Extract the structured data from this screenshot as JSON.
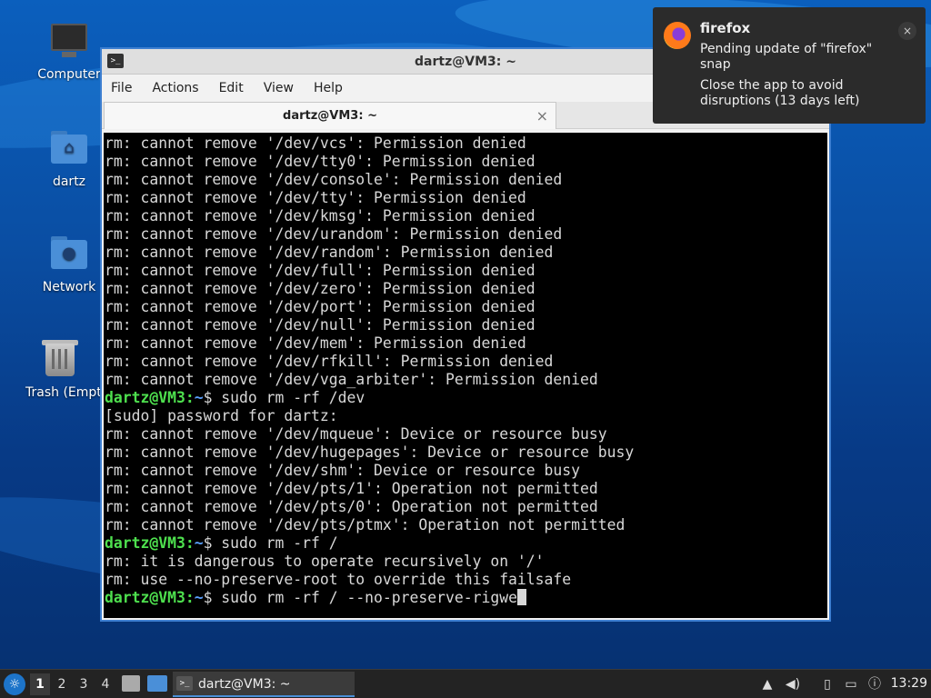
{
  "desktop": {
    "icons": [
      {
        "label": "Computer"
      },
      {
        "label": "dartz"
      },
      {
        "label": "Network"
      },
      {
        "label": "Trash (Empty)"
      }
    ]
  },
  "window": {
    "title": "dartz@VM3: ~",
    "menu": [
      "File",
      "Actions",
      "Edit",
      "View",
      "Help"
    ],
    "tab_label": "dartz@VM3: ~",
    "tab_close": "×"
  },
  "terminal": {
    "lines": [
      {
        "text": "rm: cannot remove '/dev/vcs': Permission denied"
      },
      {
        "text": "rm: cannot remove '/dev/tty0': Permission denied"
      },
      {
        "text": "rm: cannot remove '/dev/console': Permission denied"
      },
      {
        "text": "rm: cannot remove '/dev/tty': Permission denied"
      },
      {
        "text": "rm: cannot remove '/dev/kmsg': Permission denied"
      },
      {
        "text": "rm: cannot remove '/dev/urandom': Permission denied"
      },
      {
        "text": "rm: cannot remove '/dev/random': Permission denied"
      },
      {
        "text": "rm: cannot remove '/dev/full': Permission denied"
      },
      {
        "text": "rm: cannot remove '/dev/zero': Permission denied"
      },
      {
        "text": "rm: cannot remove '/dev/port': Permission denied"
      },
      {
        "text": "rm: cannot remove '/dev/null': Permission denied"
      },
      {
        "text": "rm: cannot remove '/dev/mem': Permission denied"
      },
      {
        "text": "rm: cannot remove '/dev/rfkill': Permission denied"
      },
      {
        "text": "rm: cannot remove '/dev/vga_arbiter': Permission denied"
      },
      {
        "prompt": true,
        "user": "dartz@VM3",
        "path": "~",
        "cmd": "$ sudo rm -rf /dev"
      },
      {
        "text": "[sudo] password for dartz:"
      },
      {
        "text": "rm: cannot remove '/dev/mqueue': Device or resource busy"
      },
      {
        "text": "rm: cannot remove '/dev/hugepages': Device or resource busy"
      },
      {
        "text": "rm: cannot remove '/dev/shm': Device or resource busy"
      },
      {
        "text": "rm: cannot remove '/dev/pts/1': Operation not permitted"
      },
      {
        "text": "rm: cannot remove '/dev/pts/0': Operation not permitted"
      },
      {
        "text": "rm: cannot remove '/dev/pts/ptmx': Operation not permitted"
      },
      {
        "prompt": true,
        "user": "dartz@VM3",
        "path": "~",
        "cmd": "$ sudo rm -rf /"
      },
      {
        "text": "rm: it is dangerous to operate recursively on '/'"
      },
      {
        "text": "rm: use --no-preserve-root to override this failsafe"
      },
      {
        "prompt": true,
        "user": "dartz@VM3",
        "path": "~",
        "cmd": "$ sudo rm -rf / --no-preserve-rigwe",
        "cursor": true
      }
    ]
  },
  "notification": {
    "title": "firefox",
    "line1": "Pending update of \"firefox\" snap",
    "line2": "Close the app to avoid disruptions (13 days left)",
    "close": "×"
  },
  "taskbar": {
    "workspaces": [
      "1",
      "2",
      "3",
      "4"
    ],
    "active_workspace": "1",
    "task_label": "dartz@VM3: ~",
    "clock": "13:29"
  },
  "colors": {
    "prompt_user": "#4ee04e",
    "prompt_path": "#5aa0ff",
    "window_border": "#3d7fd1"
  }
}
